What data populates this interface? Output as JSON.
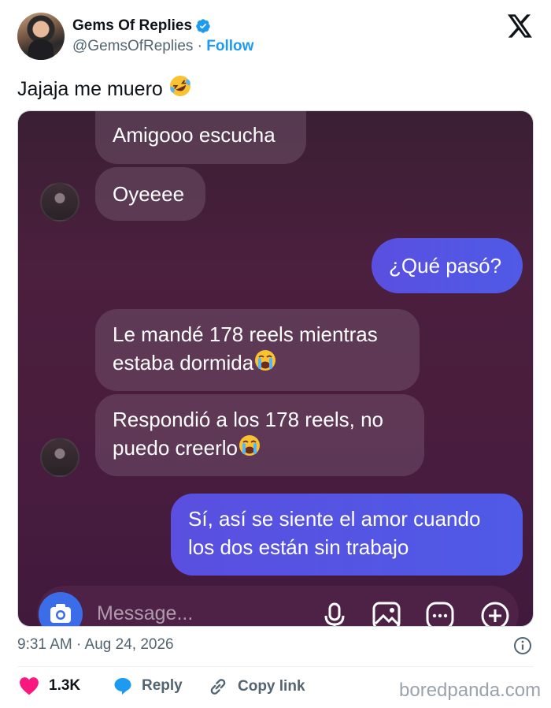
{
  "author": {
    "name": "Gems Of Replies",
    "handle": "@GemsOfReplies",
    "separator": " · ",
    "follow_label": "Follow"
  },
  "tweet": {
    "text": "Jajaja me muero",
    "emoji": "rolling-on-floor-laughing"
  },
  "chat": {
    "messages": [
      {
        "side": "in",
        "text": "Amigooo escucha"
      },
      {
        "side": "in",
        "text": "Oyeeee"
      },
      {
        "side": "out",
        "text": "¿Qué pasó?"
      },
      {
        "side": "in",
        "lines": [
          "Le mandé 178 reels mientras",
          "estaba dormida"
        ],
        "emoji": "loudly-crying-face"
      },
      {
        "side": "in",
        "lines": [
          "Respondió a los 178 reels, no",
          "puedo creerlo"
        ],
        "emoji": "loudly-crying-face"
      },
      {
        "side": "out",
        "lines": [
          "Sí, así se siente el amor cuando",
          "los dos están sin trabajo"
        ]
      }
    ],
    "composer_placeholder": "Message...",
    "composer_icons": [
      "camera-icon",
      "microphone-icon",
      "image-icon",
      "sticker-icon",
      "plus-icon"
    ]
  },
  "meta": {
    "timestamp": "9:31 AM · Aug 24, 2026"
  },
  "actions": {
    "likes": "1.3K",
    "reply_label": "Reply",
    "copy_label": "Copy link"
  },
  "watermark": "boredpanda.com",
  "colors": {
    "accent": "#1d9bf0",
    "like": "#f91880",
    "outgoing_bubble": "#5a4fe0"
  }
}
